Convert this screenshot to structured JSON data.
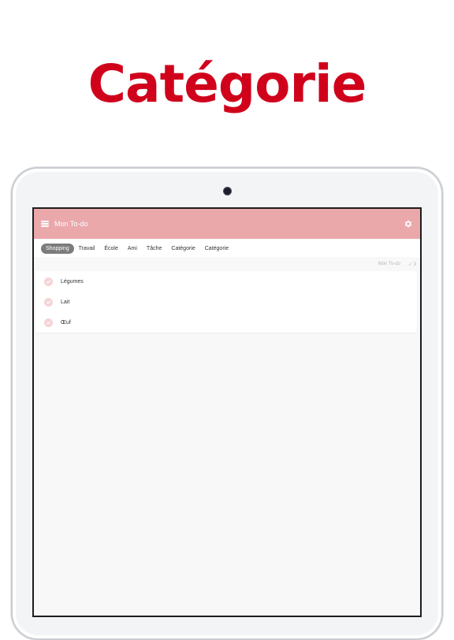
{
  "promo": {
    "title": "Catégorie"
  },
  "app": {
    "title": "Mon To-do",
    "tabs": [
      {
        "label": "Shopping",
        "active": true
      },
      {
        "label": "Travail",
        "active": false
      },
      {
        "label": "École",
        "active": false
      },
      {
        "label": "Ami",
        "active": false
      },
      {
        "label": "Tâche",
        "active": false
      },
      {
        "label": "Catégorie",
        "active": false
      },
      {
        "label": "Catégorie",
        "active": false
      }
    ],
    "meta": {
      "list_name": "Mon To-do",
      "done_count": "✓ 3"
    },
    "items": [
      {
        "label": "Légumes",
        "icon": "check-icon"
      },
      {
        "label": "Lait",
        "icon": "check-icon"
      },
      {
        "label": "Œuf",
        "icon": "check-icon"
      }
    ]
  },
  "colors": {
    "promo_title": "#d0021b",
    "topbar": "#eaa8ab",
    "active_tab": "#7c7c7c",
    "check_bg": "#f6d3d4",
    "check_mark": "#ffffff"
  }
}
